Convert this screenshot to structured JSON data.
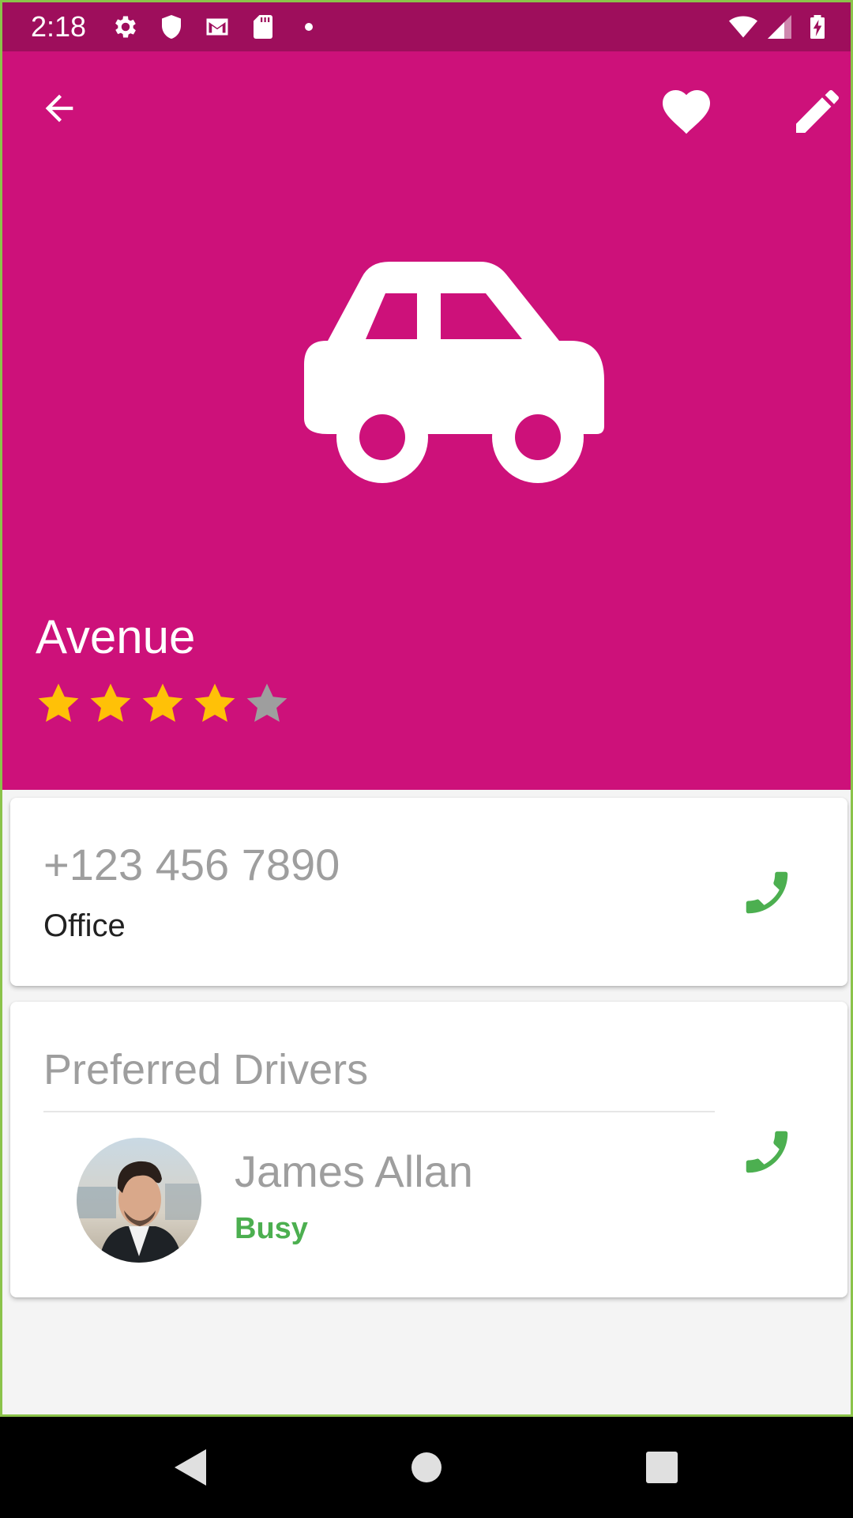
{
  "status_bar": {
    "time": "2:18",
    "icons": [
      "settings-icon",
      "shield-icon",
      "gmail-icon",
      "sd-card-icon",
      "notification-dot",
      "wifi-icon",
      "signal-icon",
      "battery-charging-icon"
    ]
  },
  "header": {
    "background_color": "#cd117a",
    "title": "Avenue",
    "rating": 4,
    "rating_max": 5,
    "icons": {
      "back": "arrow-back-icon",
      "favorite": "heart-icon",
      "edit": "pencil-icon",
      "hero": "car-icon"
    }
  },
  "phone_card": {
    "number": "+123 456 7890",
    "label": "Office",
    "call_icon": "phone-icon"
  },
  "drivers_card": {
    "title": "Preferred Drivers",
    "drivers": [
      {
        "name": "James Allan",
        "status": "Busy",
        "status_color": "#4caf50"
      }
    ]
  },
  "nav_bar": {
    "buttons": [
      "back-triangle-icon",
      "home-circle-icon",
      "recents-square-icon"
    ]
  },
  "colors": {
    "status_bar": "#9e0e5c",
    "accent_green": "#4caf50",
    "star_filled": "#ffc107",
    "star_empty": "#9e9e9e"
  }
}
